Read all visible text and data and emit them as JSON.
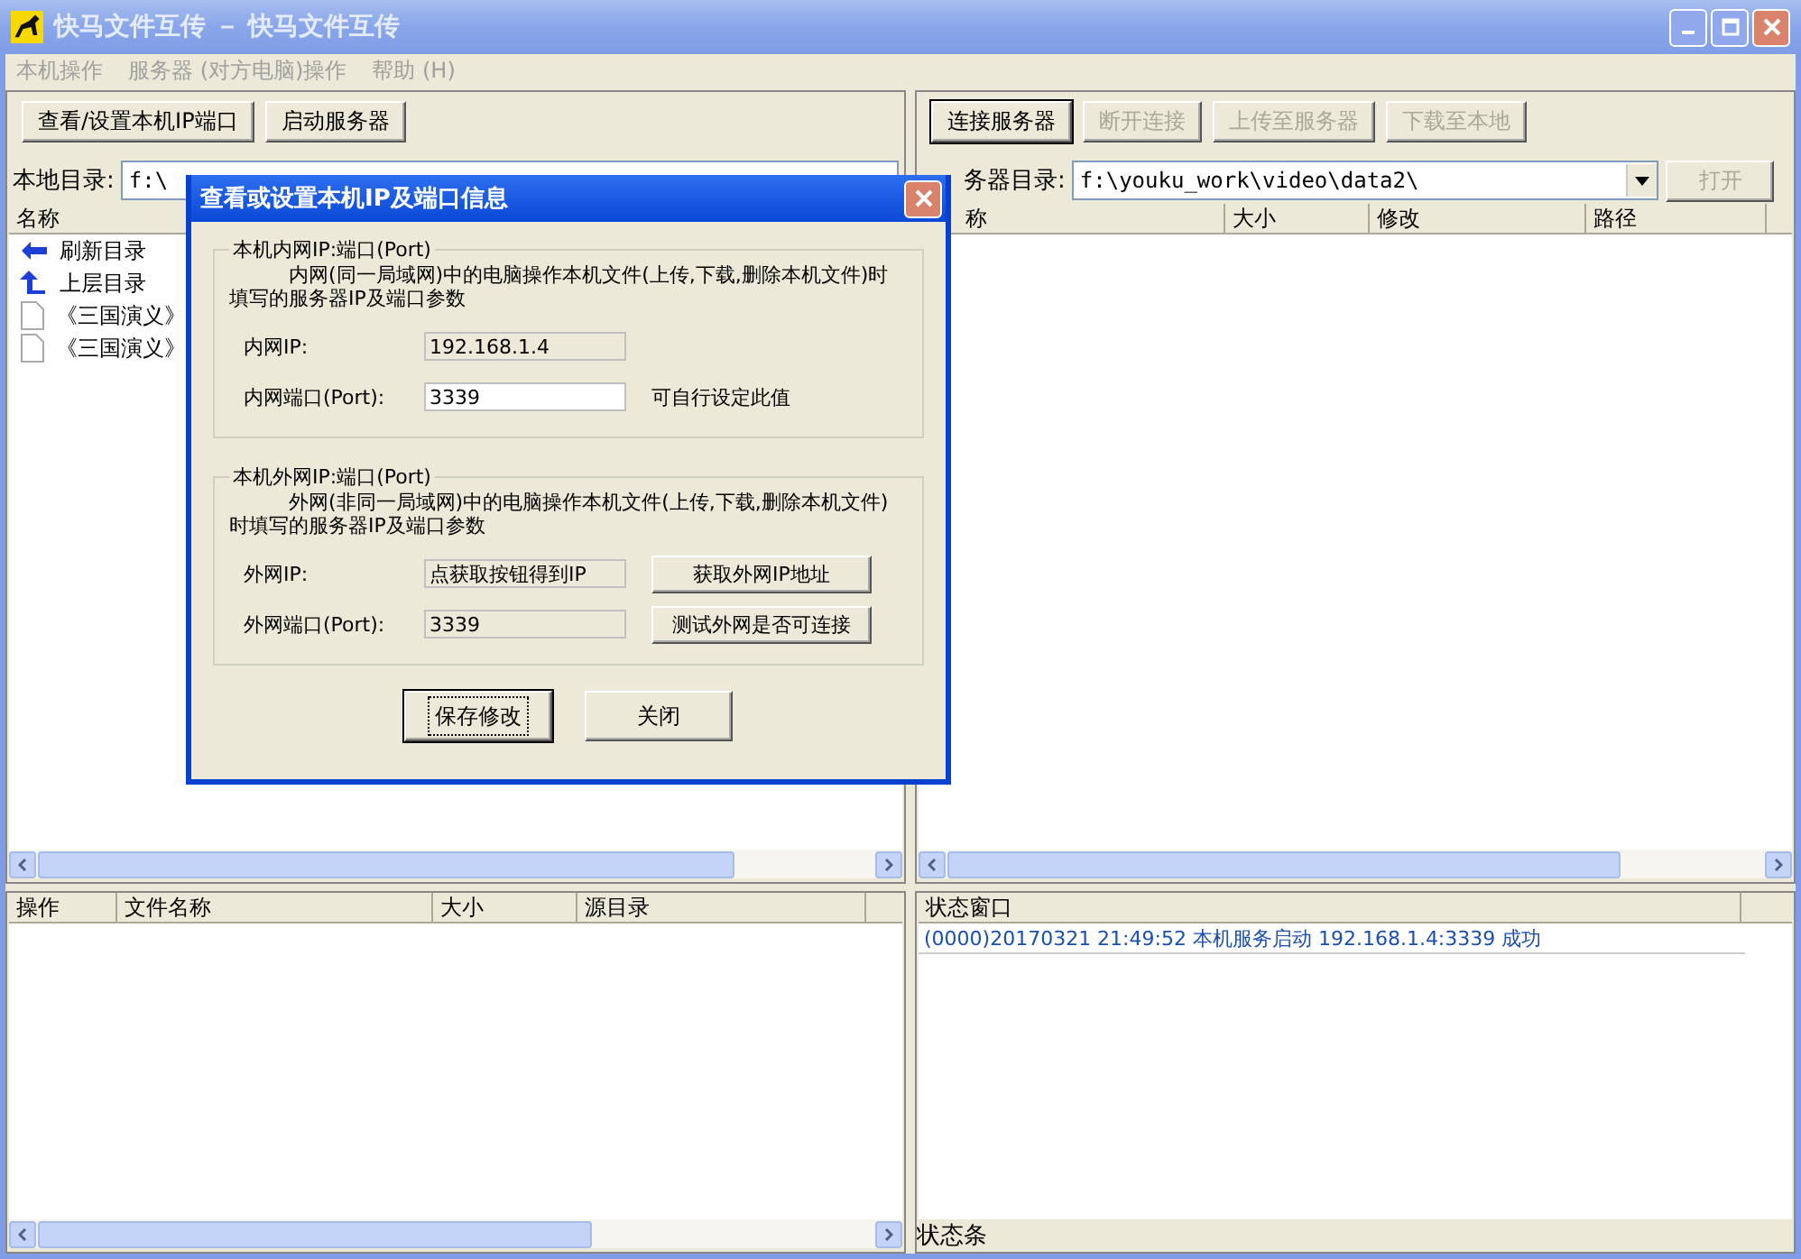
{
  "window": {
    "title": "快马文件互传 － 快马文件互传",
    "menu": [
      "本机操作",
      "服务器 (对方电脑)操作",
      "帮助 (H)"
    ]
  },
  "left_toolbar": [
    {
      "label": "查看/设置本机IP端口",
      "disabled": false
    },
    {
      "label": "启动服务器",
      "disabled": false
    }
  ],
  "local_dir": {
    "label": "本地目录:",
    "value": "f:\\"
  },
  "local_list": {
    "columns": [
      "名称"
    ],
    "items": [
      {
        "name": "刷新目录",
        "kind": "back"
      },
      {
        "name": "上层目录",
        "kind": "up"
      },
      {
        "name": "《三国演义》",
        "kind": "file"
      },
      {
        "name": "《三国演义》",
        "kind": "file"
      }
    ]
  },
  "right_toolbar": [
    {
      "label": "连接服务器",
      "disabled": false
    },
    {
      "label": "断开连接",
      "disabled": true
    },
    {
      "label": "上传至服务器",
      "disabled": true
    },
    {
      "label": "下载至本地",
      "disabled": true
    }
  ],
  "server_dir": {
    "label": "务器目录:",
    "value": "f:\\youku_work\\video\\data2\\",
    "open_button": {
      "label": "打开",
      "disabled": true
    }
  },
  "server_list": {
    "columns": [
      "称",
      "大小",
      "修改",
      "路径"
    ]
  },
  "transfer_list": {
    "columns": [
      "操作",
      "文件名称",
      "大小",
      "源目录"
    ]
  },
  "status_window": {
    "columns": [
      "状态窗口"
    ],
    "rows": [
      "(0000)20170321 21:49:52 本机服务启动 192.168.1.4:3339 成功"
    ]
  },
  "status_bar": "状态条",
  "dialog": {
    "title": "查看或设置本机IP及端口信息",
    "groups": [
      {
        "legend": "本机内网IP:端口(Port)",
        "description": "内网(同一局域网)中的电脑操作本机文件(上传,下载,删除本机文件)时填写的服务器IP及端口参数",
        "fields": [
          {
            "label": "内网IP:",
            "value": "192.168.1.4",
            "readonly": true
          },
          {
            "label": "内网端口(Port):",
            "value": "3339",
            "readonly": false,
            "note": "可自行设定此值"
          }
        ]
      },
      {
        "legend": "本机外网IP:端口(Port)",
        "description": "外网(非同一局域网)中的电脑操作本机文件(上传,下载,删除本机文件)时填写的服务器IP及端口参数",
        "fields": [
          {
            "label": "外网IP:",
            "value": "点获取按钮得到IP",
            "readonly": true,
            "button": "获取外网IP地址"
          },
          {
            "label": "外网端口(Port):",
            "value": "3339",
            "readonly": true,
            "button": "测试外网是否可连接"
          }
        ]
      }
    ],
    "buttons": [
      {
        "label": "保存修改",
        "default": true
      },
      {
        "label": "关闭",
        "default": false
      }
    ]
  }
}
